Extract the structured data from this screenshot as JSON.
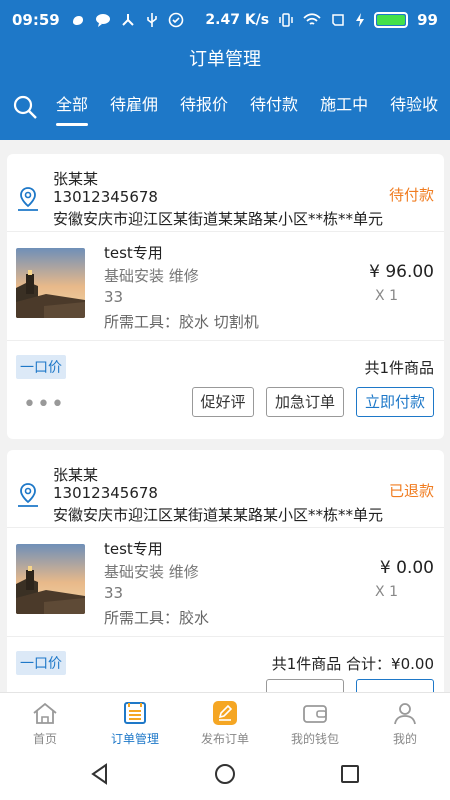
{
  "status_bar": {
    "time": "09:59",
    "network_speed": "2.47 K/s",
    "battery": "99",
    "colors": {
      "bar": "#1e78c8",
      "battery_fill": "#44e04a"
    }
  },
  "header": {
    "title": "订单管理"
  },
  "tabs": [
    {
      "label": "全部",
      "active": true
    },
    {
      "label": "待雇佣",
      "active": false
    },
    {
      "label": "待报价",
      "active": false
    },
    {
      "label": "待付款",
      "active": false
    },
    {
      "label": "施工中",
      "active": false
    },
    {
      "label": "待验收",
      "active": false
    }
  ],
  "orders": [
    {
      "contact_name": "张某某",
      "phone": "13012345678",
      "address": "安徽安庆市迎江区某街道某某路某小区**栋**单元",
      "status": "待付款",
      "goods": {
        "title": "test专用",
        "service": "基础安装 维修",
        "number": "33",
        "tools": "所需工具：胶水 切割机",
        "price": "¥ 96.00",
        "count": "X 1"
      },
      "price_tag": "一口价",
      "summary": "共1件商品",
      "more": "•••",
      "buttons": {
        "praise": "促好评",
        "urgent": "加急订单",
        "pay": "立即付款"
      }
    },
    {
      "contact_name": "张某某",
      "phone": "13012345678",
      "address": "安徽安庆市迎江区某街道某某路某小区**栋**单元",
      "status": "已退款",
      "goods": {
        "title": "test专用",
        "service": "基础安装 维修",
        "number": "33",
        "tools": "所需工具：胶水",
        "price": "¥ 0.00",
        "count": "X 1"
      },
      "price_tag": "一口价",
      "summary": "共1件商品  合计：¥0.00"
    }
  ],
  "bottom_nav": [
    {
      "label": "首页",
      "icon": "home-icon",
      "active": false
    },
    {
      "label": "订单管理",
      "icon": "order-list-icon",
      "active": true
    },
    {
      "label": "发布订单",
      "icon": "publish-icon",
      "active": false
    },
    {
      "label": "我的钱包",
      "icon": "wallet-icon",
      "active": false
    },
    {
      "label": "我的",
      "icon": "profile-icon",
      "active": false
    }
  ],
  "colors": {
    "primary": "#1e78c8",
    "status_orange": "#f07c20",
    "tag_bg": "#dce9f7",
    "publish_orange": "#f5a623"
  }
}
